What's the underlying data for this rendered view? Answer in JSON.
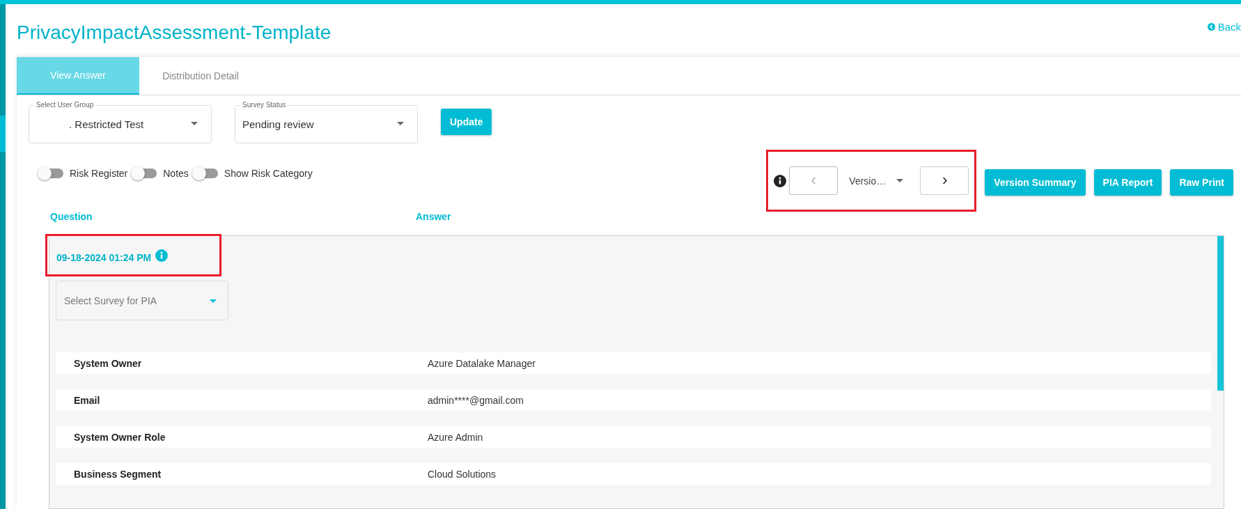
{
  "page": {
    "title": "PrivacyImpactAssessment-Template",
    "back_link": "Back"
  },
  "tabs": [
    {
      "label": "View Answer",
      "selected": true
    },
    {
      "label": "Distribution Detail",
      "selected": false
    }
  ],
  "filters": [
    {
      "label": "Select User Group",
      "value": ". Restricted Test"
    },
    {
      "label": "Survey Status",
      "value": "Pending review"
    }
  ],
  "update_button": "Update",
  "toggles": [
    {
      "label": "Risk Register",
      "on": false
    },
    {
      "label": "Notes",
      "on": false
    },
    {
      "label": "Show Risk Category",
      "on": false
    }
  ],
  "version_nav": {
    "highlighted": true,
    "version": "Versio…",
    "prev_disabled": true,
    "next_disabled": false
  },
  "actions": [
    "Version Summary",
    "PIA Report",
    "Raw Print"
  ],
  "columns": [
    "Question",
    "Answer"
  ],
  "version_block": {
    "timestamp": "09-18-2024 01:24 PM",
    "highlighted": true,
    "survey_select": {
      "placeholder": "Select Survey for PIA"
    }
  },
  "rows": [
    {
      "question": "System Owner",
      "answer": "Azure Datalake Manager"
    },
    {
      "question": "Email",
      "answer": "admin****@gmail.com"
    },
    {
      "question": "System Owner Role",
      "answer": "Azure Admin"
    },
    {
      "question": "Business Segment",
      "answer": "Cloud Solutions"
    }
  ]
}
